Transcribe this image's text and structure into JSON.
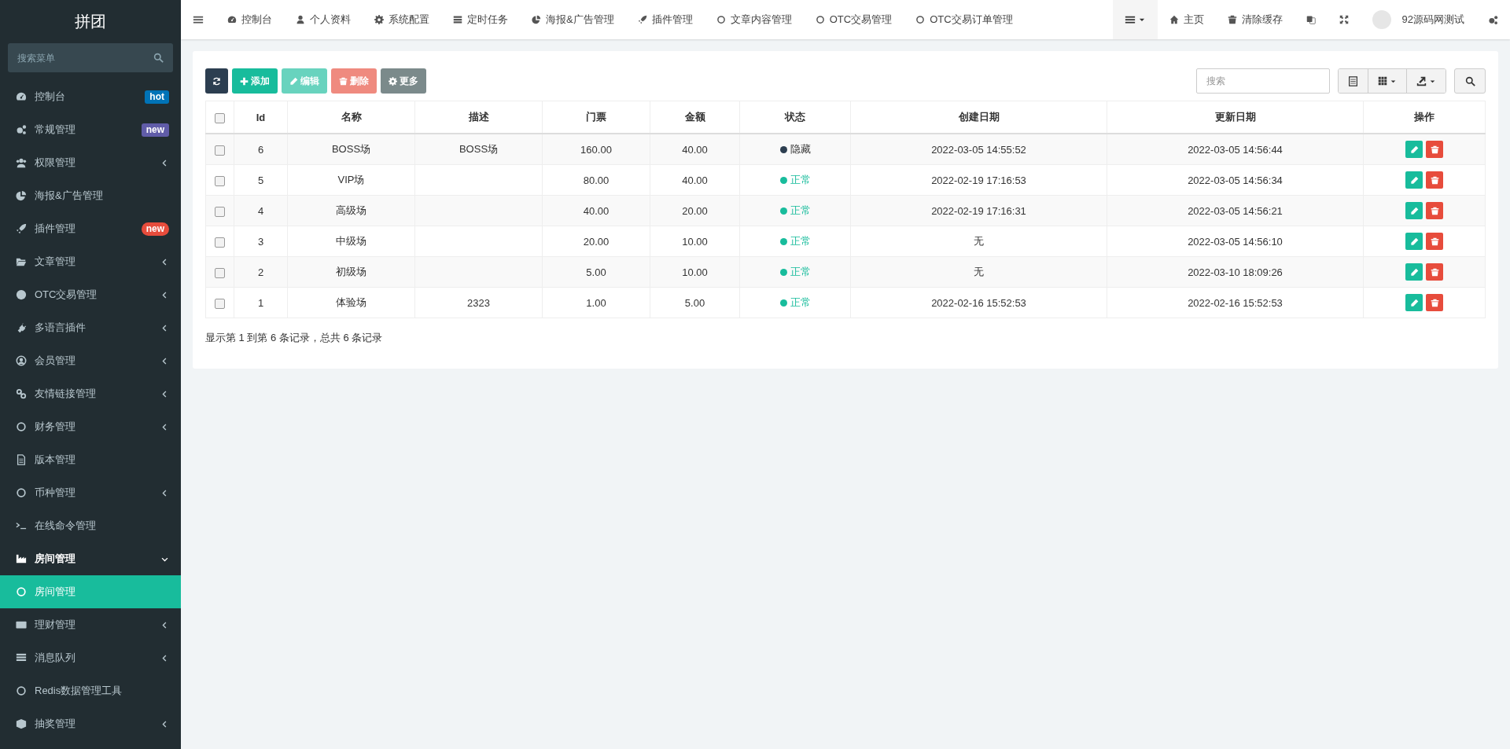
{
  "sidebar": {
    "logo": "拼团",
    "search": {
      "placeholder": "搜索菜单"
    },
    "items": [
      {
        "label": "控制台",
        "kind": "link",
        "selected": false,
        "badge": {
          "text": "hot",
          "color": "#0073b7"
        }
      },
      {
        "label": "常规管理",
        "kind": "link",
        "selected": false,
        "badge": {
          "text": "new",
          "color": "#605ca8"
        }
      },
      {
        "label": "权限管理",
        "kind": "menu",
        "selected": false,
        "expanded": false
      },
      {
        "label": "海报&广告管理",
        "kind": "link",
        "selected": false
      },
      {
        "label": "插件管理",
        "kind": "link",
        "selected": false,
        "badge": {
          "text": "new",
          "color": "#e74c3c"
        }
      },
      {
        "label": "文章管理",
        "kind": "menu",
        "selected": false,
        "expanded": false
      },
      {
        "label": "OTC交易管理",
        "kind": "menu",
        "selected": false,
        "expanded": false
      },
      {
        "label": "多语言插件",
        "kind": "menu",
        "selected": false,
        "expanded": false
      },
      {
        "label": "会员管理",
        "kind": "menu",
        "selected": false,
        "expanded": false
      },
      {
        "label": "友情链接管理",
        "kind": "menu",
        "selected": false,
        "expanded": false
      },
      {
        "label": "财务管理",
        "kind": "menu",
        "selected": false,
        "expanded": false
      },
      {
        "label": "版本管理",
        "kind": "link",
        "selected": false
      },
      {
        "label": "币种管理",
        "kind": "menu",
        "selected": false,
        "expanded": false
      },
      {
        "label": "在线命令管理",
        "kind": "link",
        "selected": false
      },
      {
        "label": "房间管理",
        "kind": "menu",
        "selected": true,
        "expanded": true,
        "children": [
          {
            "label": "房间管理",
            "selected": true
          }
        ]
      },
      {
        "label": "理财管理",
        "kind": "menu",
        "selected": false,
        "expanded": false
      },
      {
        "label": "消息队列",
        "kind": "menu",
        "selected": false,
        "expanded": false
      },
      {
        "label": "Redis数据管理工具",
        "kind": "link",
        "selected": false
      },
      {
        "label": "抽奖管理",
        "kind": "menu",
        "selected": false,
        "expanded": false
      }
    ]
  },
  "top_nav": {
    "items": [
      "控制台",
      "个人资料",
      "系统配置",
      "定时任务",
      "海报&广告管理",
      "插件管理",
      "文章内容管理",
      "OTC交易管理",
      "OTC交易订单管理"
    ],
    "home": "主页",
    "clear_cache": "清除缓存",
    "user": "92源码网测试"
  },
  "toolbar": {
    "buttons": [
      {
        "kind": "refresh",
        "disabled": false
      },
      {
        "kind": "add",
        "label": "添加",
        "disabled": false
      },
      {
        "kind": "edit",
        "label": "编辑",
        "disabled": true
      },
      {
        "kind": "delete",
        "label": "删除",
        "disabled": true
      },
      {
        "kind": "more",
        "label": "更多",
        "disabled": false
      }
    ],
    "search": {
      "placeholder": "搜索"
    }
  },
  "table": {
    "select_all_checked": false,
    "columns": [
      "Id",
      "名称",
      "描述",
      "门票",
      "金额",
      "状态",
      "创建日期",
      "更新日期",
      "操作"
    ],
    "rows": [
      {
        "checked": false,
        "id": "6",
        "name": "BOSS场",
        "description": "BOSS场",
        "ticket": "160.00",
        "amount": "40.00",
        "status": {
          "text": "隐藏",
          "color": "#2c3e50"
        },
        "created": "2022-03-05 14:55:52",
        "updated": "2022-03-05 14:56:44"
      },
      {
        "checked": false,
        "id": "5",
        "name": "VIP场",
        "ticket": "80.00",
        "amount": "40.00",
        "status": {
          "text": "正常",
          "color": "#18bc9c"
        },
        "created": "2022-02-19 17:16:53",
        "updated": "2022-03-05 14:56:34"
      },
      {
        "checked": false,
        "id": "4",
        "name": "高级场",
        "ticket": "40.00",
        "amount": "20.00",
        "status": {
          "text": "正常",
          "color": "#18bc9c"
        },
        "created": "2022-02-19 17:16:31",
        "updated": "2022-03-05 14:56:21"
      },
      {
        "checked": false,
        "id": "3",
        "name": "中级场",
        "ticket": "20.00",
        "amount": "10.00",
        "status": {
          "text": "正常",
          "color": "#18bc9c"
        },
        "created": "无",
        "updated": "2022-03-05 14:56:10"
      },
      {
        "checked": false,
        "id": "2",
        "name": "初级场",
        "ticket": "5.00",
        "amount": "10.00",
        "status": {
          "text": "正常",
          "color": "#18bc9c"
        },
        "created": "无",
        "updated": "2022-03-10 18:09:26"
      },
      {
        "checked": false,
        "id": "1",
        "name": "体验场",
        "description": "2323",
        "ticket": "1.00",
        "amount": "5.00",
        "status": {
          "text": "正常",
          "color": "#18bc9c"
        },
        "created": "2022-02-16 15:52:53",
        "updated": "2022-02-16 15:52:53"
      }
    ],
    "footer": "显示第 1 到第 6 条记录，总共 6 条记录"
  }
}
